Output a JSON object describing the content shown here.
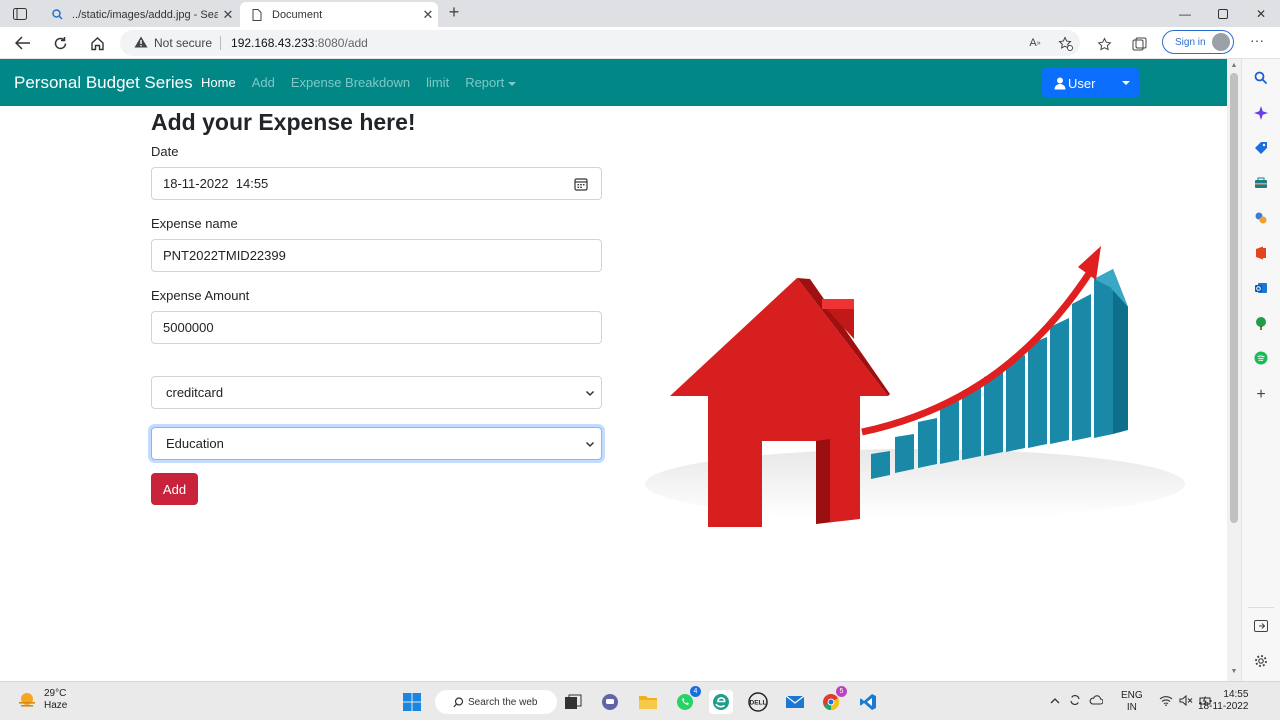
{
  "browser": {
    "tabs": [
      {
        "title": "../static/images/addd.jpg - Searc",
        "icon": "search-icon",
        "active": false
      },
      {
        "title": "Document",
        "icon": "document-icon",
        "active": true
      }
    ],
    "address": {
      "security_label": "Not secure",
      "host": "192.168.43.233",
      "path": ":8080/add"
    },
    "sign_in_label": "Sign in"
  },
  "navbar": {
    "brand": "Personal Budget Series",
    "links": [
      "Home",
      "Add",
      "Expense Breakdown",
      "limit",
      "Report"
    ],
    "active_link": "Home",
    "user_label": "User",
    "bg_color": "#018786"
  },
  "form": {
    "title": "Add your Expense here!",
    "date_label": "Date",
    "date_value": "18-11-2022  14:55",
    "name_label": "Expense name",
    "name_value": "PNT2022TMID22399",
    "amount_label": "Expense Amount",
    "amount_value": "5000000",
    "payment_select": "creditcard",
    "category_select": "Education",
    "submit_label": "Add",
    "submit_color": "#c8233b"
  },
  "taskbar": {
    "weather_temp": "29°C",
    "weather_desc": "Haze",
    "search_label": "Search the web",
    "whatsapp_badge": "4",
    "chrome_badge": "5",
    "lang_top": "ENG",
    "lang_bottom": "IN",
    "time": "14:55",
    "date": "18-11-2022"
  }
}
